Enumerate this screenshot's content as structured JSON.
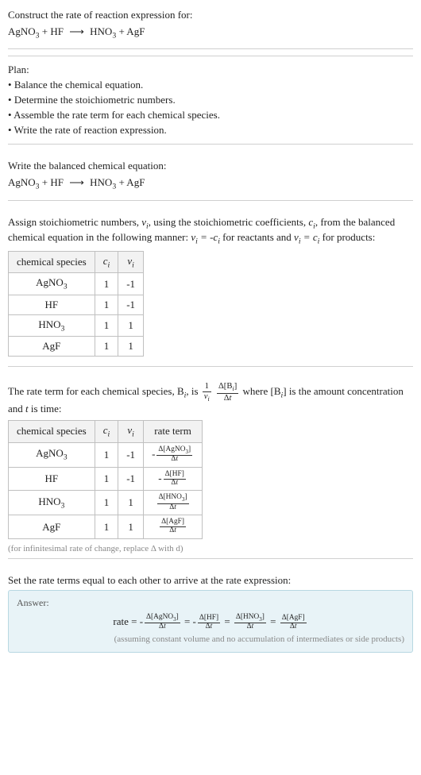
{
  "header": {
    "title": "Construct the rate of reaction expression for:",
    "equation_lhs1": "AgNO",
    "equation_lhs2": " + HF ",
    "equation_rhs1": " HNO",
    "equation_rhs2": " + AgF"
  },
  "plan": {
    "title": "Plan:",
    "items": [
      "Balance the chemical equation.",
      "Determine the stoichiometric numbers.",
      "Assemble the rate term for each chemical species.",
      "Write the rate of reaction expression."
    ]
  },
  "balanced": {
    "title": "Write the balanced chemical equation:"
  },
  "assign": {
    "text_a": "Assign stoichiometric numbers, ",
    "nu_i": "ν",
    "text_b": ", using the stoichiometric coefficients, ",
    "c_i": "c",
    "text_c": ", from the balanced chemical equation in the following manner: ",
    "text_d": " for reactants and ",
    "text_e": " for products:",
    "table": {
      "headers": [
        "chemical species",
        "cᵢ",
        "νᵢ"
      ],
      "rows": [
        [
          "AgNO₃",
          "1",
          "-1"
        ],
        [
          "HF",
          "1",
          "-1"
        ],
        [
          "HNO₃",
          "1",
          "1"
        ],
        [
          "AgF",
          "1",
          "1"
        ]
      ]
    }
  },
  "rateterm": {
    "text_a": "The rate term for each chemical species, B",
    "text_b": ", is ",
    "text_c": " where [B",
    "text_d": "] is the amount concentration and ",
    "t": "t",
    "text_e": " is time:",
    "table": {
      "headers": [
        "chemical species",
        "cᵢ",
        "νᵢ",
        "rate term"
      ],
      "rows": [
        {
          "sp": "AgNO₃",
          "c": "1",
          "nu": "-1",
          "neg": "-",
          "num": "Δ[AgNO₃]",
          "den": "Δt"
        },
        {
          "sp": "HF",
          "c": "1",
          "nu": "-1",
          "neg": "-",
          "num": "Δ[HF]",
          "den": "Δt"
        },
        {
          "sp": "HNO₃",
          "c": "1",
          "nu": "1",
          "neg": "",
          "num": "Δ[HNO₃]",
          "den": "Δt"
        },
        {
          "sp": "AgF",
          "c": "1",
          "nu": "1",
          "neg": "",
          "num": "Δ[AgF]",
          "den": "Δt"
        }
      ]
    },
    "note": "(for infinitesimal rate of change, replace Δ with d)"
  },
  "final": {
    "title": "Set the rate terms equal to each other to arrive at the rate expression:",
    "answer_label": "Answer:",
    "rate_label": "rate = ",
    "assume": "(assuming constant volume and no accumulation of intermediates or side products)"
  }
}
